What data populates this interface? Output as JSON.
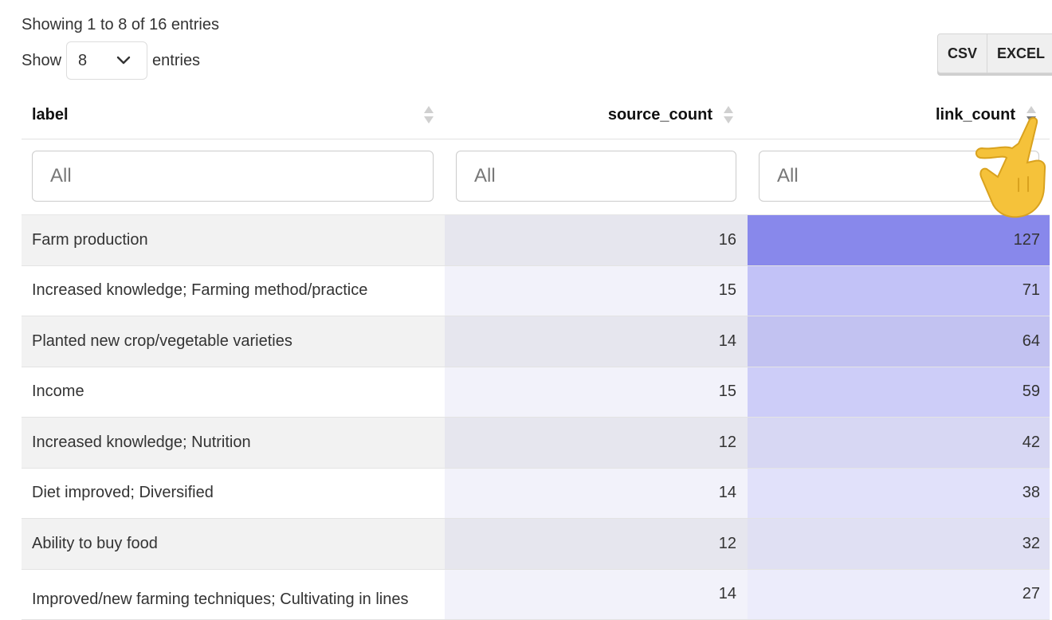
{
  "info": "Showing 1 to 8 of 16 entries",
  "length": {
    "prefix": "Show",
    "value": "8",
    "suffix": "entries"
  },
  "export_buttons": {
    "csv": "CSV",
    "excel": "EXCEL"
  },
  "columns": [
    {
      "label": "label"
    },
    {
      "label": "source_count"
    },
    {
      "label": "link_count",
      "sorted": true
    }
  ],
  "filters": {
    "label": "All",
    "source_count": "All",
    "link_count": "All"
  },
  "rows": [
    {
      "label": "Farm production",
      "source_count": "16",
      "link_count": "127"
    },
    {
      "label": "Increased knowledge; Farming method/practice",
      "source_count": "15",
      "link_count": "71"
    },
    {
      "label": "Planted new crop/vegetable varieties",
      "source_count": "14",
      "link_count": "64"
    },
    {
      "label": "Income",
      "source_count": "15",
      "link_count": "59"
    },
    {
      "label": "Increased knowledge; Nutrition",
      "source_count": "12",
      "link_count": "42"
    },
    {
      "label": "Diet improved; Diversified",
      "source_count": "14",
      "link_count": "38"
    },
    {
      "label": "Ability to buy food",
      "source_count": "12",
      "link_count": "32"
    },
    {
      "label": "Improved/new farming techniques; Cultivating in lines",
      "source_count": "14",
      "link_count": "27"
    }
  ],
  "colors": {
    "link_bar_max": "#8c8cf2",
    "link_bar_min": "#ececfb",
    "cursor": "#f5c23a"
  },
  "icons": {
    "select_caret": "chevron-down-icon",
    "sort": "sort-arrows-icon",
    "cursor": "pointing-hand-icon"
  }
}
